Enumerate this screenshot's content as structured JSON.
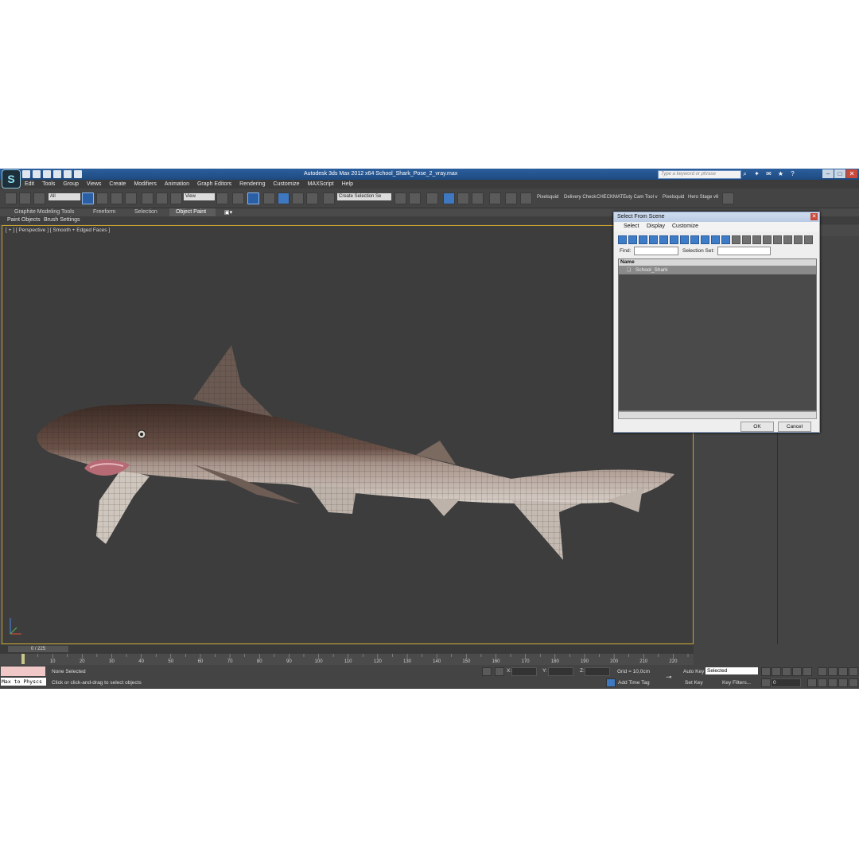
{
  "window": {
    "title": "Autodesk 3ds Max  2012 x64     School_Shark_Pose_2_vray.max",
    "search_placeholder": "Type a keyword or phrase"
  },
  "menu": [
    "Edit",
    "Tools",
    "Group",
    "Views",
    "Create",
    "Modifiers",
    "Animation",
    "Graph Editors",
    "Rendering",
    "Customize",
    "MAXScript",
    "Help"
  ],
  "toolbar": {
    "filter_value": "All",
    "ref_coord_value": "View",
    "selection_set_value": "Create Selection Se",
    "labels": [
      "Pixelsquid",
      "Delivery Check",
      "CHECKMATE",
      "uty Cam Tool v",
      "Pixelsquid",
      "Hero Stage v6"
    ]
  },
  "ribbon": {
    "tabs": [
      "Graphite Modeling Tools",
      "Freeform",
      "Selection",
      "Object Paint"
    ],
    "sub_tabs": [
      "Paint Objects",
      "Brush Settings"
    ]
  },
  "viewport": {
    "label": "[ + ] [ Perspective ] [ Smooth + Edged Faces ]"
  },
  "dialog": {
    "title": "Select From Scene",
    "menu": [
      "Select",
      "Display",
      "Customize"
    ],
    "find_label": "Find:",
    "selection_set_label": "Selection Set:",
    "column_name": "Name",
    "row": "School_Shark",
    "ok": "OK",
    "cancel": "Cancel"
  },
  "timeline": {
    "frame_display": "0 / 225",
    "ticks": [
      "10",
      "20",
      "30",
      "40",
      "50",
      "60",
      "70",
      "80",
      "90",
      "100",
      "110",
      "120",
      "130",
      "140",
      "150",
      "160",
      "170",
      "180",
      "190",
      "200",
      "210",
      "220"
    ]
  },
  "status": {
    "maxscript": "Max to Physcs",
    "selection": "None Selected",
    "prompt": "Click or click-and-drag to select objects",
    "x_label": "X:",
    "y_label": "Y:",
    "z_label": "Z:",
    "grid": "Grid = 10,0cm",
    "add_time_tag": "Add Time Tag",
    "auto_key": "Auto Key",
    "set_key": "Set Key",
    "selected_value": "Selected",
    "key_filters": "Key Filters...",
    "frame_value": "0"
  },
  "colors": {
    "accent": "#3e78c0",
    "viewport_border": "#c8a332",
    "background": "#444444"
  }
}
